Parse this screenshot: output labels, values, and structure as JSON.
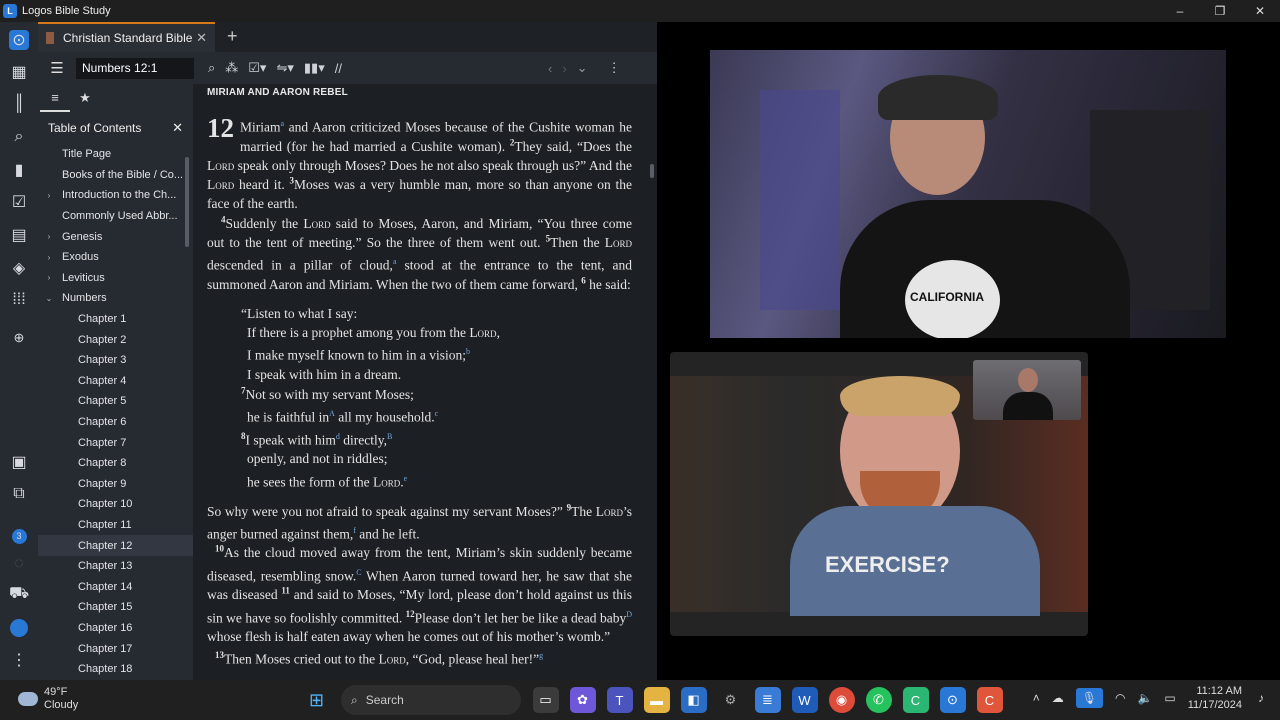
{
  "app": {
    "title": "Logos Bible Study"
  },
  "window_controls": {
    "minimize": "–",
    "maximize": "❐",
    "close": "✕"
  },
  "tab": {
    "title": "Christian Standard Bible",
    "close": "✕",
    "new": "+"
  },
  "toolbar": {
    "reference": "Numbers 12:1"
  },
  "toc": {
    "title": "Table of Contents",
    "close": "✕",
    "items": [
      {
        "label": "Title Page",
        "chev": ""
      },
      {
        "label": "Books of the Bible / Co...",
        "chev": ""
      },
      {
        "label": "Introduction to the Ch...",
        "chev": "›"
      },
      {
        "label": "Commonly Used Abbr...",
        "chev": ""
      },
      {
        "label": "Genesis",
        "chev": "›"
      },
      {
        "label": "Exodus",
        "chev": "›"
      },
      {
        "label": "Leviticus",
        "chev": "›"
      },
      {
        "label": "Numbers",
        "chev": "⌄"
      },
      {
        "label": "Chapter 1",
        "chev": ""
      },
      {
        "label": "Chapter 2",
        "chev": ""
      },
      {
        "label": "Chapter 3",
        "chev": ""
      },
      {
        "label": "Chapter 4",
        "chev": ""
      },
      {
        "label": "Chapter 5",
        "chev": ""
      },
      {
        "label": "Chapter 6",
        "chev": ""
      },
      {
        "label": "Chapter 7",
        "chev": ""
      },
      {
        "label": "Chapter 8",
        "chev": ""
      },
      {
        "label": "Chapter 9",
        "chev": ""
      },
      {
        "label": "Chapter 10",
        "chev": ""
      },
      {
        "label": "Chapter 11",
        "chev": ""
      },
      {
        "label": "Chapter 12",
        "chev": ""
      },
      {
        "label": "Chapter 13",
        "chev": ""
      },
      {
        "label": "Chapter 14",
        "chev": ""
      },
      {
        "label": "Chapter 15",
        "chev": ""
      },
      {
        "label": "Chapter 16",
        "chev": ""
      },
      {
        "label": "Chapter 17",
        "chev": ""
      },
      {
        "label": "Chapter 18",
        "chev": ""
      }
    ],
    "selected": "Chapter 12"
  },
  "reader": {
    "heading": "MIRIAM AND AARON REBEL",
    "chapter": "12"
  },
  "webcams": {
    "shirt1": "CALIFORNIA",
    "shirt2": "EXERCISE?"
  },
  "taskbar": {
    "weather_temp": "49°F",
    "weather_desc": "Cloudy",
    "search": "Search",
    "time": "11:12 AM",
    "date": "11/17/2024",
    "badge": "3"
  }
}
